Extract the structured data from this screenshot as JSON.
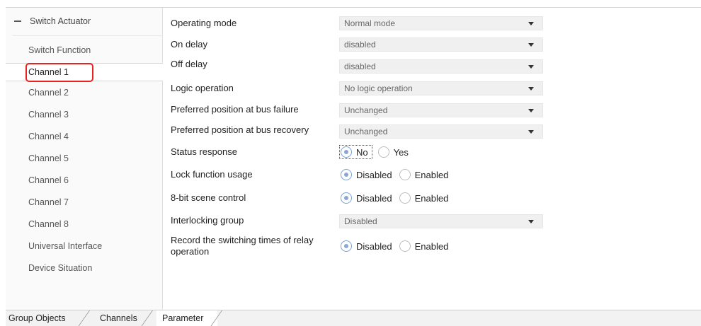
{
  "sidebar": {
    "root_label": "Switch Actuator",
    "items": [
      {
        "label": "Switch Function"
      },
      {
        "label": "Channel 1"
      },
      {
        "label": "Channel 2"
      },
      {
        "label": "Channel 3"
      },
      {
        "label": "Channel 4"
      },
      {
        "label": "Channel 5"
      },
      {
        "label": "Channel 6"
      },
      {
        "label": "Channel 7"
      },
      {
        "label": "Channel 8"
      },
      {
        "label": "Universal Interface"
      },
      {
        "label": "Device Situation"
      }
    ],
    "selected": "Channel 1"
  },
  "params": {
    "operating_mode": {
      "label": "Operating mode",
      "value": "Normal mode"
    },
    "on_delay": {
      "label": "On delay",
      "value": "disabled"
    },
    "off_delay": {
      "label": "Off delay",
      "value": "disabled"
    },
    "logic_operation": {
      "label": "Logic operation",
      "value": "No logic operation"
    },
    "pref_bus_failure": {
      "label": "Preferred position at bus failure",
      "value": "Unchanged"
    },
    "pref_bus_recovery": {
      "label": "Preferred position at bus recovery",
      "value": "Unchanged"
    },
    "status_response": {
      "label": "Status response",
      "opt1": "No",
      "opt2": "Yes",
      "selected": "No"
    },
    "lock_function": {
      "label": "Lock function usage",
      "opt1": "Disabled",
      "opt2": "Enabled",
      "selected": "Disabled"
    },
    "scene_control": {
      "label": "8-bit scene control",
      "opt1": "Disabled",
      "opt2": "Enabled",
      "selected": "Disabled"
    },
    "interlocking": {
      "label": "Interlocking group",
      "value": "Disabled"
    },
    "record_switching": {
      "label_line1": "Record the switching times of relay",
      "label_line2": "operation",
      "opt1": "Disabled",
      "opt2": "Enabled",
      "selected": "Disabled"
    }
  },
  "tabs": [
    {
      "label": "Group Objects"
    },
    {
      "label": "Channels"
    },
    {
      "label": "Parameter"
    }
  ],
  "active_tab": "Parameter",
  "colors": {
    "highlight": "#e8231f",
    "radio_checked": "#8aa7d6"
  }
}
